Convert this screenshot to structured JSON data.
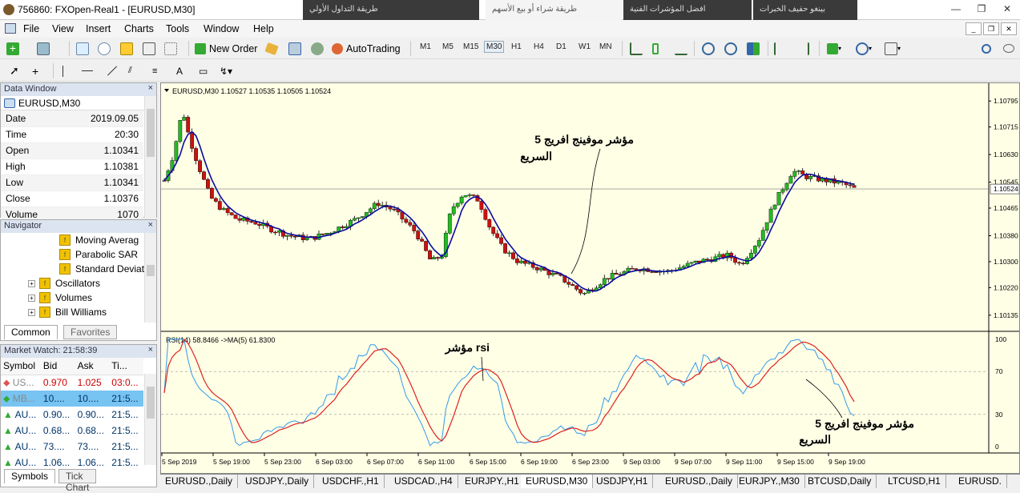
{
  "window": {
    "title": "756860: FXOpen-Real1 - [EURUSD,M30]",
    "bg_tabs": [
      "طريقة التداول الأولي",
      "طريقة شراء أو بيع الأسهم",
      "افضل المؤشرات الفنية",
      "بينغو حفيف الخبرات"
    ]
  },
  "menu": [
    "File",
    "View",
    "Insert",
    "Charts",
    "Tools",
    "Window",
    "Help"
  ],
  "toolbar": {
    "new_order": "New Order",
    "autotrading": "AutoTrading",
    "timeframes": [
      "M1",
      "M5",
      "M15",
      "M30",
      "H1",
      "H4",
      "D1",
      "W1",
      "MN"
    ],
    "selected_timeframe": "M30"
  },
  "data_window": {
    "title": "Data Window",
    "symbol": "EURUSD,M30",
    "rows": [
      {
        "label": "Date",
        "value": "2019.09.05"
      },
      {
        "label": "Time",
        "value": "20:30"
      },
      {
        "label": "Open",
        "value": "1.10341"
      },
      {
        "label": "High",
        "value": "1.10381"
      },
      {
        "label": "Low",
        "value": "1.10341"
      },
      {
        "label": "Close",
        "value": "1.10376"
      },
      {
        "label": "Volume",
        "value": "1070"
      }
    ]
  },
  "navigator": {
    "title": "Navigator",
    "items": [
      "Moving Averag",
      "Parabolic SAR",
      "Standard Deviat",
      "Oscillators",
      "Volumes",
      "Bill Williams"
    ],
    "tabs": [
      "Common",
      "Favorites"
    ]
  },
  "market_watch": {
    "title": "Market Watch: 21:58:39",
    "columns": [
      "Symbol",
      "Bid",
      "Ask",
      "Ti..."
    ],
    "rows": [
      {
        "symbol": "US...",
        "bid": "0.970",
        "ask": "1.025",
        "time": "03:0..."
      },
      {
        "symbol": "MB...",
        "bid": "10....",
        "ask": "10....",
        "time": "21:5..."
      },
      {
        "symbol": "AU...",
        "bid": "0.90...",
        "ask": "0.90...",
        "time": "21:5..."
      },
      {
        "symbol": "AU...",
        "bid": "0.68...",
        "ask": "0.68...",
        "time": "21:5..."
      },
      {
        "symbol": "AU...",
        "bid": "73....",
        "ask": "73....",
        "time": "21:5..."
      },
      {
        "symbol": "AU...",
        "bid": "1.06...",
        "ask": "1.06...",
        "time": "21:5..."
      }
    ],
    "tabs": [
      "Symbols",
      "Tick Chart"
    ]
  },
  "chart": {
    "header": "EURUSD,M30  1.10527 1.10535 1.10505 1.10524",
    "price_labels": [
      "1.10795",
      "1.10715",
      "1.10630",
      "1.10545",
      "1.10524",
      "1.10465",
      "1.10380",
      "1.10300",
      "1.10220",
      "1.10135"
    ],
    "current_price": "1.10524",
    "annotation_main": "مؤشر موفينج افريج 5\nالسريع",
    "rsi_header": "RSI(14) 58.8466  ->MA(5) 61.8300",
    "rsi_levels": [
      "100",
      "70",
      "30",
      "0"
    ],
    "annotation_rsi": "مؤشر rsi",
    "annotation_rsi_ma": "مؤشر موفينج افريج 5\nالسريع",
    "time_labels": [
      "5 Sep 2019",
      "5 Sep 19:00",
      "5 Sep 23:00",
      "6 Sep 03:00",
      "6 Sep 07:00",
      "6 Sep 11:00",
      "6 Sep 15:00",
      "6 Sep 19:00",
      "6 Sep 23:00",
      "9 Sep 03:00",
      "9 Sep 07:00",
      "9 Sep 11:00",
      "9 Sep 15:00",
      "9 Sep 19:00"
    ],
    "colors": {
      "bull": "#22bb22",
      "bear": "#cc1111",
      "ma": "#0a0aa0",
      "rsi": "#3399ee",
      "rsi_ma": "#dd2222",
      "bg": "#ffffe6"
    }
  },
  "chart_tabs": [
    "EURUSD.,Daily",
    "USDJPY.,Daily",
    "USDCHF.,H1",
    "USDCAD.,H4",
    "EURJPY.,H1",
    "EURUSD,M30",
    "USDJPY,H1",
    "EURUSD.,Daily",
    "EURJPY.,M30",
    "BTCUSD,Daily",
    "LTCUSD,H1",
    "EURUSD."
  ],
  "active_chart_tab": "EURUSD,M30"
}
